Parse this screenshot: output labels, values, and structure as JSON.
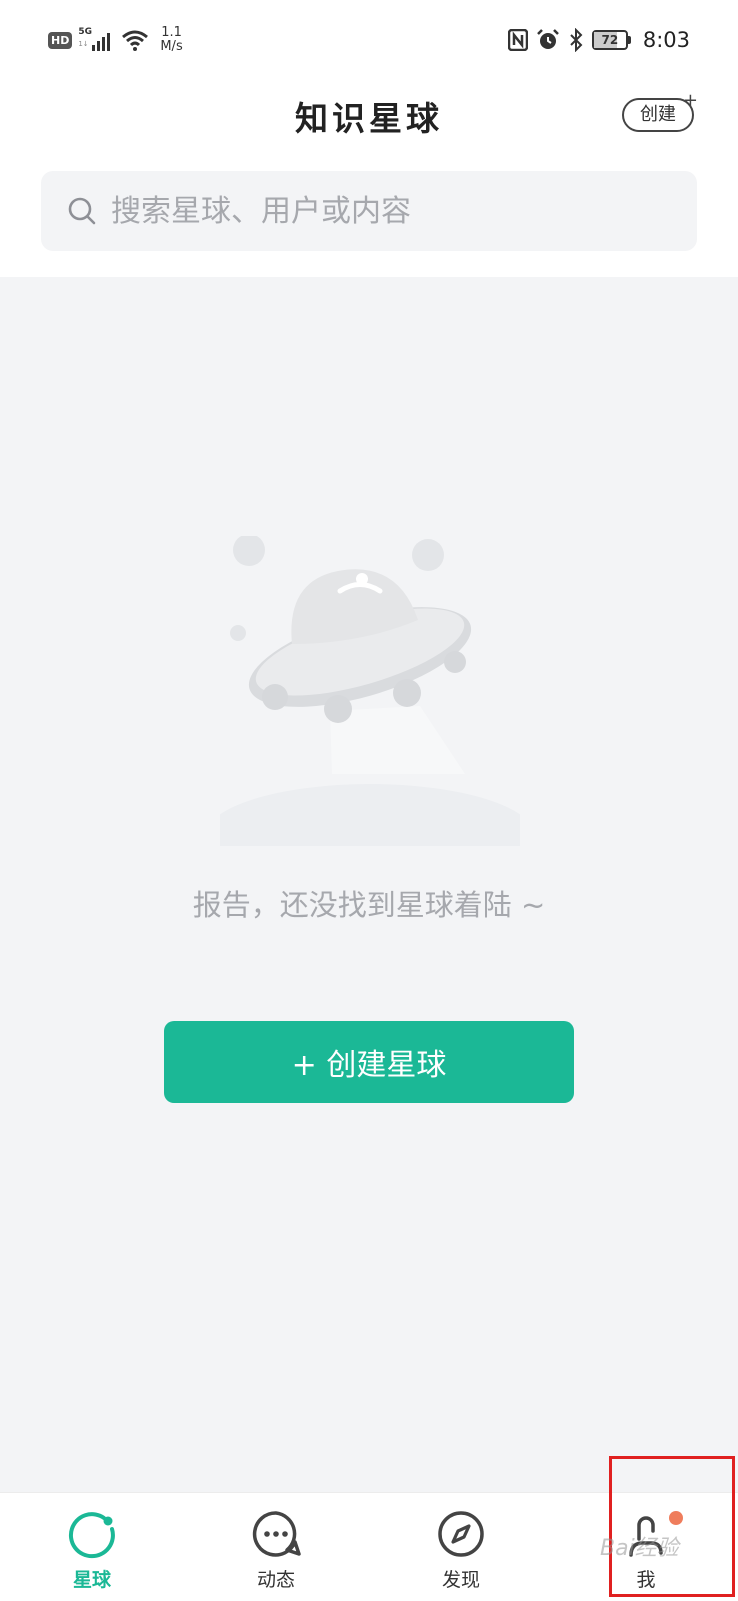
{
  "status_bar": {
    "hd": "HD",
    "network": "5G",
    "network_sub": "1↓",
    "speed_value": "1.1",
    "speed_unit": "M/s",
    "battery": "72",
    "time": "8:03"
  },
  "header": {
    "title": "知识星球",
    "create_label": "创建"
  },
  "search": {
    "placeholder": "搜索星球、用户或内容"
  },
  "empty_state": {
    "message": "报告，还没找到星球着陆 ~",
    "button_label": "+ 创建星球"
  },
  "tabs": [
    {
      "label": "星球",
      "icon": "planet-icon",
      "active": true
    },
    {
      "label": "动态",
      "icon": "chat-bubble-icon",
      "active": false
    },
    {
      "label": "发现",
      "icon": "compass-icon",
      "active": false
    },
    {
      "label": "我",
      "icon": "user-icon",
      "active": false,
      "has_badge": true
    }
  ],
  "watermark": "Bai经验",
  "colors": {
    "accent": "#1bb896",
    "badge": "#ef7d5c",
    "highlight": "#e02020",
    "background": "#f3f4f6"
  }
}
